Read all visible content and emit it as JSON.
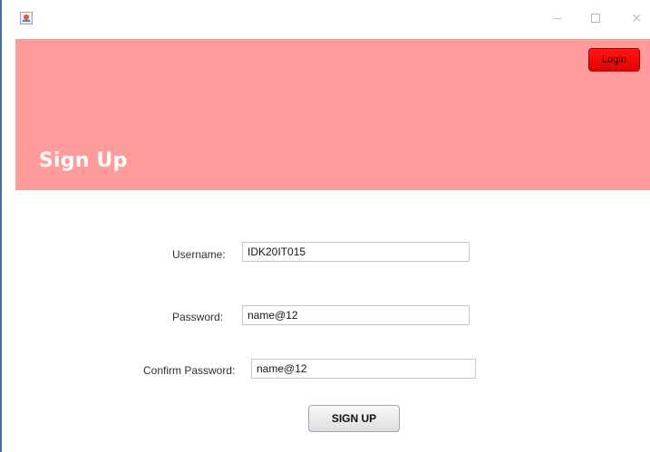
{
  "window": {
    "controls": {
      "minimize_icon": "minimize-icon",
      "maximize_icon": "maximize-icon",
      "close_icon": "close-icon"
    }
  },
  "header": {
    "title": "Sign Up",
    "login_label": "Login",
    "background_color": "#ff9b9b",
    "login_color": "#ff1616"
  },
  "form": {
    "username_label": "Username:",
    "username_value": "IDK20IT015",
    "password_label": "Password:",
    "password_value": "name@12",
    "confirm_password_label": "Confirm Password:",
    "confirm_password_value": "name@12",
    "submit_label": "SIGN UP"
  }
}
